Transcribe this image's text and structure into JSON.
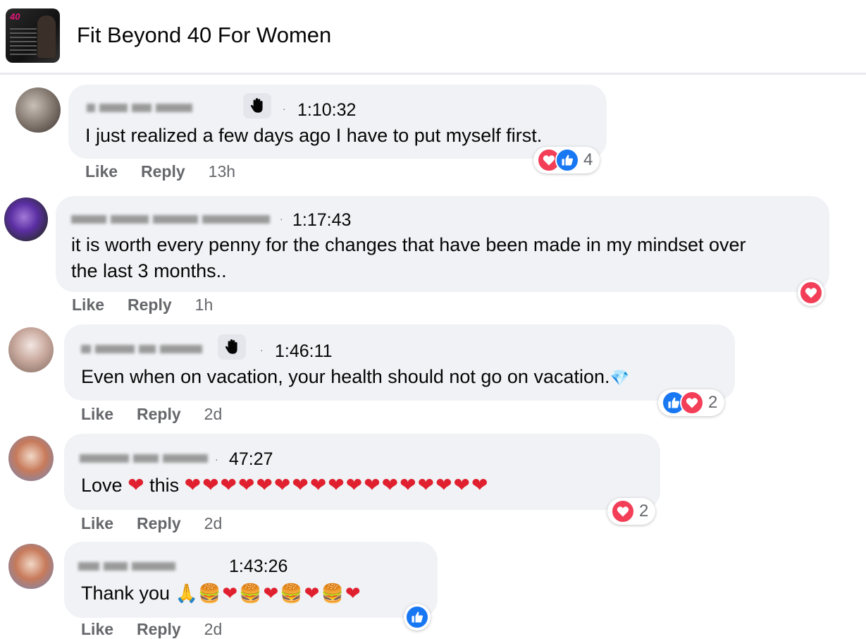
{
  "group": {
    "name": "Fit Beyond 40 For Women",
    "thumb_tag": "40"
  },
  "comments": [
    {
      "time": "1:10:32",
      "text": "I just realized a few days ago I have to put myself first.",
      "like_label": "Like",
      "reply_label": "Reply",
      "ago": "13h",
      "reactions": [
        "love",
        "like"
      ],
      "reaction_count": "4"
    },
    {
      "time": "1:17:43",
      "text_line1": "it is worth every penny for the changes that have been made in my mindset over",
      "text_line2": "the last 3 months..",
      "like_label": "Like",
      "reply_label": "Reply",
      "ago": "1h",
      "reactions": [
        "love"
      ]
    },
    {
      "time": "1:46:11",
      "text": "Even when on vacation, your health should not go on vacation.",
      "text_emoji": "💎",
      "like_label": "Like",
      "reply_label": "Reply",
      "ago": "2d",
      "reactions": [
        "like",
        "love"
      ],
      "reaction_count": "2"
    },
    {
      "time": "47:27",
      "text_a": "Love",
      "text_heart": "❤",
      "text_b": "this",
      "text_hearts": "❤❤❤❤❤❤❤❤❤❤❤❤❤❤❤❤❤",
      "like_label": "Like",
      "reply_label": "Reply",
      "ago": "2d",
      "reactions": [
        "love"
      ],
      "reaction_count": "2"
    },
    {
      "time": "1:43:26",
      "text": "Thank you",
      "text_emoji": "🙏",
      "text_emoji_sequence": "🍔❤🍔❤🍔❤🍔❤",
      "like_label": "Like",
      "reply_label": "Reply",
      "ago": "2d",
      "reactions": [
        "like"
      ]
    }
  ],
  "colors": {
    "bubble": "#f0f2f5",
    "love": "#f33e58",
    "like": "#1877f2",
    "meta": "#65676b"
  },
  "icons": [
    "wave-badge-icon",
    "love-reaction-icon",
    "like-reaction-icon"
  ]
}
